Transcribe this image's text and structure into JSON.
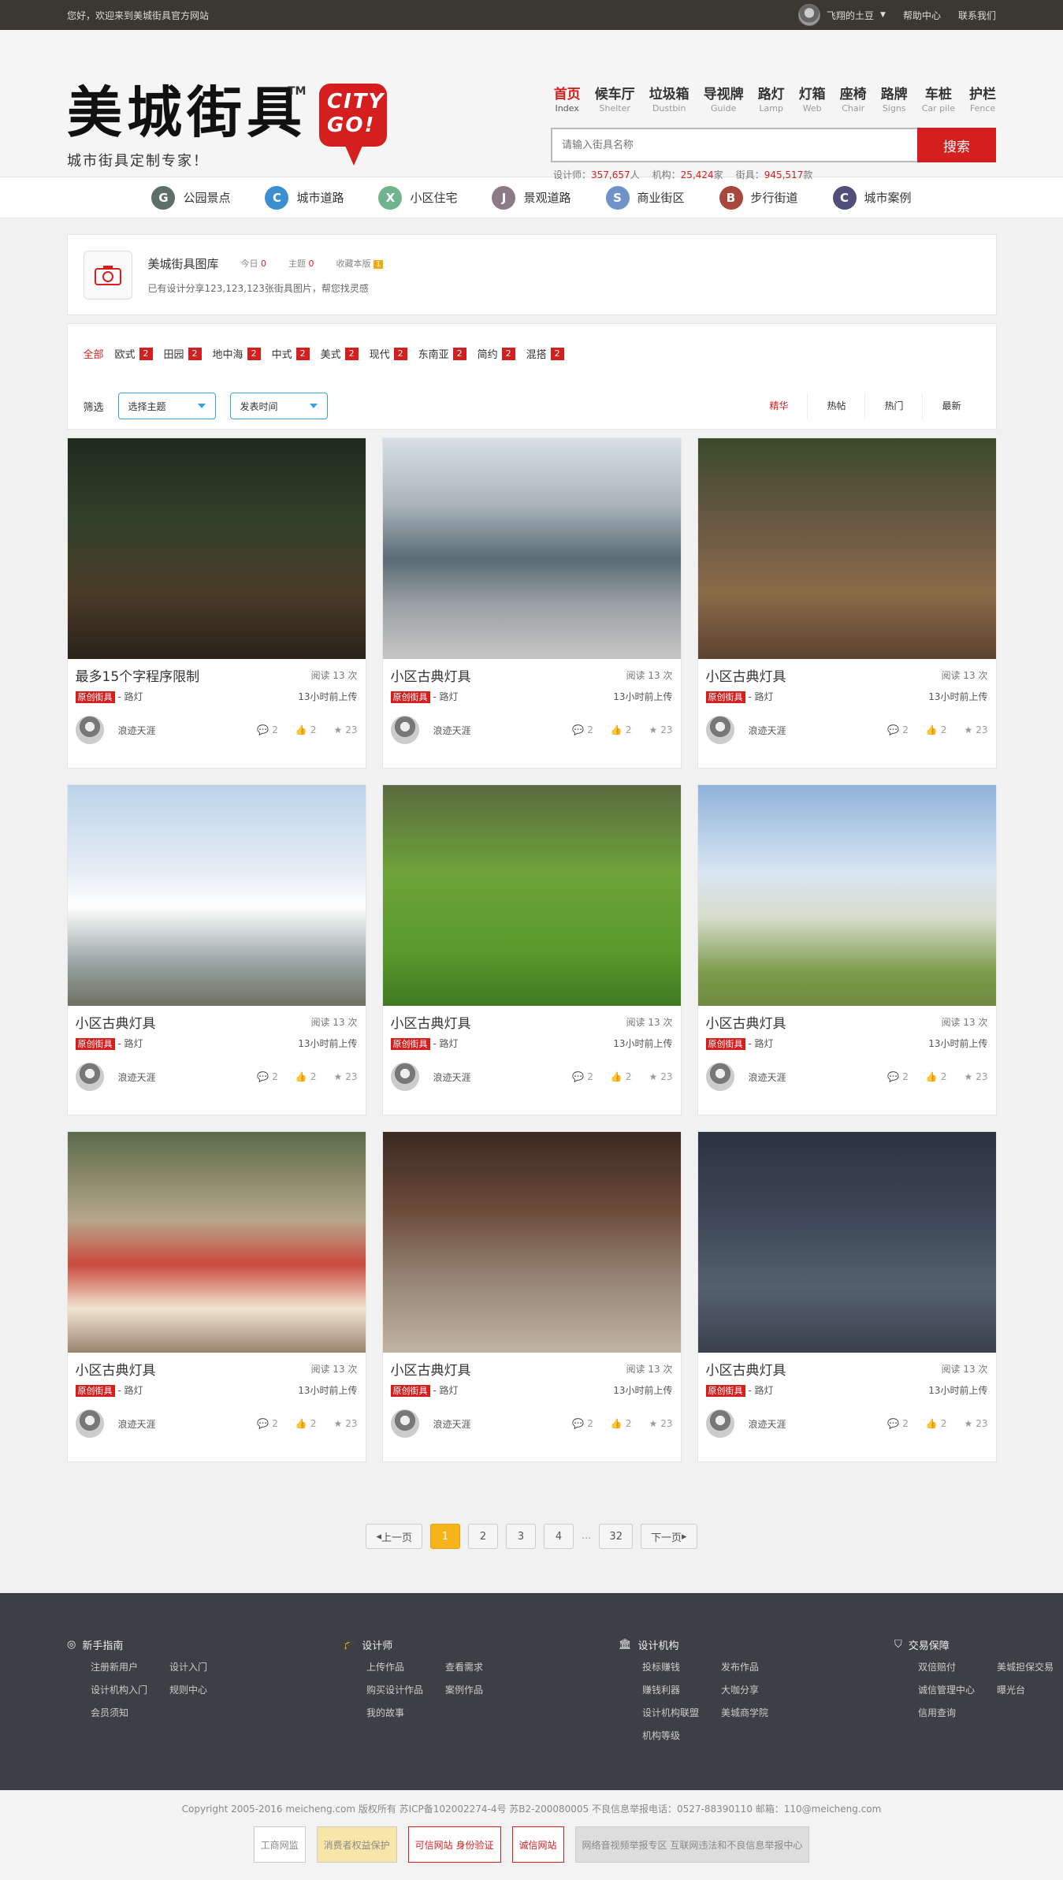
{
  "topbar": {
    "welcome": "您好，欢迎来到美城街具官方网站",
    "user": "飞翔的土豆",
    "help": "帮助中心",
    "contact": "联系我们"
  },
  "logo": {
    "text": "美城街具",
    "tm": "TM",
    "sub": "城市街具定制专家！",
    "badge_line1": "CITY",
    "badge_line2": "GO!"
  },
  "nav": [
    {
      "zh": "首页",
      "en": "Index"
    },
    {
      "zh": "候车厅",
      "en": "Shelter"
    },
    {
      "zh": "垃圾箱",
      "en": "Dustbin"
    },
    {
      "zh": "导视牌",
      "en": "Guide"
    },
    {
      "zh": "路灯",
      "en": "Lamp"
    },
    {
      "zh": "灯箱",
      "en": "Web"
    },
    {
      "zh": "座椅",
      "en": "Chair"
    },
    {
      "zh": "路牌",
      "en": "Signs"
    },
    {
      "zh": "车桩",
      "en": "Car pile"
    },
    {
      "zh": "护栏",
      "en": "Fence"
    }
  ],
  "search": {
    "placeholder": "请输入街具名称",
    "button": "搜索"
  },
  "stats": {
    "designer_label": "设计师：",
    "designer": "357,657",
    "designer_unit": "人",
    "org_label": "机构：",
    "org": "25,424",
    "org_unit": "家",
    "item_label": "街具：",
    "item": "945,517",
    "item_unit": "款"
  },
  "subnav": [
    {
      "letter": "G",
      "label": "公园景点",
      "color": "#5e6e6a"
    },
    {
      "letter": "C",
      "label": "城市道路",
      "color": "#3d8ed0"
    },
    {
      "letter": "X",
      "label": "小区住宅",
      "color": "#6fb38f"
    },
    {
      "letter": "J",
      "label": "景观道路",
      "color": "#8b7a88"
    },
    {
      "letter": "S",
      "label": "商业街区",
      "color": "#6f93c8"
    },
    {
      "letter": "B",
      "label": "步行街道",
      "color": "#a8473d"
    },
    {
      "letter": "C",
      "label": "城市案例",
      "color": "#4f4f7a"
    }
  ],
  "gallery": {
    "title": "美城街具图库",
    "today_label": "今日",
    "today": "0",
    "topic_label": "主题",
    "topic": "0",
    "fav_label": "收藏本版",
    "fav": "1",
    "desc": "已有设计分享123,123,123张街具图片，帮您找灵感"
  },
  "categories": [
    {
      "label": "全部",
      "count": ""
    },
    {
      "label": "欧式",
      "count": "2"
    },
    {
      "label": "田园",
      "count": "2"
    },
    {
      "label": "地中海",
      "count": "2"
    },
    {
      "label": "中式",
      "count": "2"
    },
    {
      "label": "美式",
      "count": "2"
    },
    {
      "label": "现代",
      "count": "2"
    },
    {
      "label": "东南亚",
      "count": "2"
    },
    {
      "label": "简约",
      "count": "2"
    },
    {
      "label": "混搭",
      "count": "2"
    }
  ],
  "filter": {
    "label": "筛选",
    "theme": "选择主题",
    "time": "发表时间",
    "sorts": [
      "精华",
      "热帖",
      "热门",
      "最新"
    ]
  },
  "cards": [
    {
      "title": "最多15个字程序限制",
      "reads": "阅读 13 次",
      "tag": "原创街具",
      "type": "- 路灯",
      "time": "13小时前上传",
      "author": "浪迹天涯",
      "comments": "2",
      "likes": "2",
      "stars": "23"
    },
    {
      "title": "小区古典灯具",
      "reads": "阅读 13 次",
      "tag": "原创街具",
      "type": "- 路灯",
      "time": "13小时前上传",
      "author": "浪迹天涯",
      "comments": "2",
      "likes": "2",
      "stars": "23"
    },
    {
      "title": "小区古典灯具",
      "reads": "阅读 13 次",
      "tag": "原创街具",
      "type": "- 路灯",
      "time": "13小时前上传",
      "author": "浪迹天涯",
      "comments": "2",
      "likes": "2",
      "stars": "23"
    },
    {
      "title": "小区古典灯具",
      "reads": "阅读 13 次",
      "tag": "原创街具",
      "type": "- 路灯",
      "time": "13小时前上传",
      "author": "浪迹天涯",
      "comments": "2",
      "likes": "2",
      "stars": "23"
    },
    {
      "title": "小区古典灯具",
      "reads": "阅读 13 次",
      "tag": "原创街具",
      "type": "- 路灯",
      "time": "13小时前上传",
      "author": "浪迹天涯",
      "comments": "2",
      "likes": "2",
      "stars": "23"
    },
    {
      "title": "小区古典灯具",
      "reads": "阅读 13 次",
      "tag": "原创街具",
      "type": "- 路灯",
      "time": "13小时前上传",
      "author": "浪迹天涯",
      "comments": "2",
      "likes": "2",
      "stars": "23"
    },
    {
      "title": "小区古典灯具",
      "reads": "阅读 13 次",
      "tag": "原创街具",
      "type": "- 路灯",
      "time": "13小时前上传",
      "author": "浪迹天涯",
      "comments": "2",
      "likes": "2",
      "stars": "23"
    },
    {
      "title": "小区古典灯具",
      "reads": "阅读 13 次",
      "tag": "原创街具",
      "type": "- 路灯",
      "time": "13小时前上传",
      "author": "浪迹天涯",
      "comments": "2",
      "likes": "2",
      "stars": "23"
    },
    {
      "title": "小区古典灯具",
      "reads": "阅读 13 次",
      "tag": "原创街具",
      "type": "- 路灯",
      "time": "13小时前上传",
      "author": "浪迹天涯",
      "comments": "2",
      "likes": "2",
      "stars": "23"
    }
  ],
  "pager": {
    "prev": "上一页",
    "pages": [
      "1",
      "2",
      "3",
      "4"
    ],
    "dots": "...",
    "last": "32",
    "next": "下一页"
  },
  "footer": [
    {
      "title": "新手指南",
      "links": [
        "注册新用户",
        "设计入门",
        "设计机构入门",
        "规则中心",
        "会员须知"
      ]
    },
    {
      "title": "设计师",
      "links": [
        "上传作品",
        "查看需求",
        "购买设计作品",
        "案例作品",
        "我的故事"
      ]
    },
    {
      "title": "设计机构",
      "links": [
        "投标赚钱",
        "发布作品",
        "赚钱利器",
        "大咖分享",
        "设计机构联盟",
        "美城商学院",
        "机构等级"
      ]
    },
    {
      "title": "交易保障",
      "links": [
        "双倍赔付",
        "美城担保交易",
        "诚信管理中心",
        "曝光台",
        "信用查询"
      ]
    }
  ],
  "copyright": "Copyright 2005-2016 meicheng.com 版权所有  苏ICP备102002274-4号  苏B2-200080005 不良信息举报电话：0527-88390110 邮箱：110@meicheng.com",
  "badges": [
    "工商网监",
    "消费者权益保护",
    "可信网站 身份验证",
    "诚信网站",
    "网络音视频举报专区 互联网违法和不良信息举报中心"
  ]
}
